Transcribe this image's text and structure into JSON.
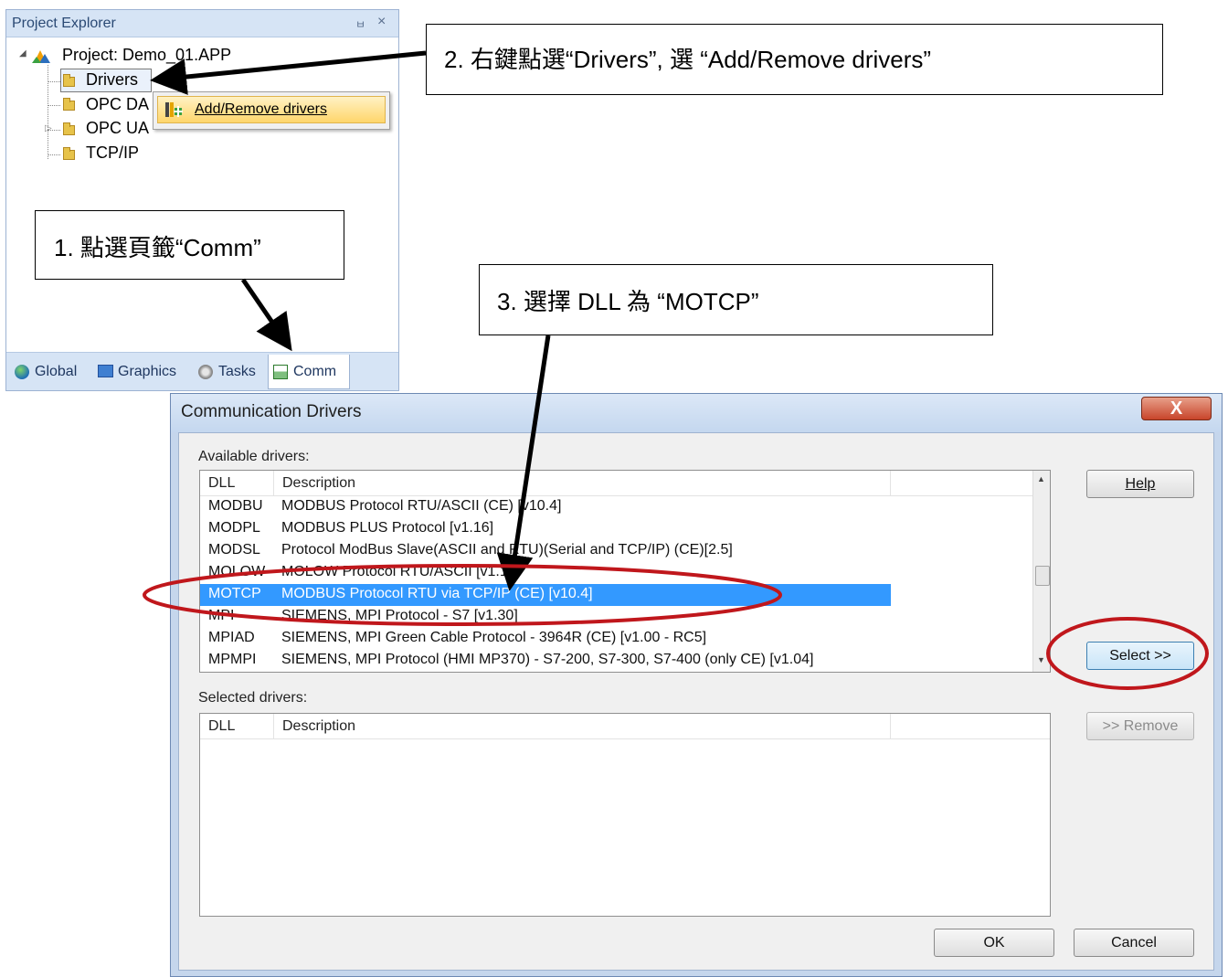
{
  "project_explorer": {
    "title": "Project Explorer",
    "pin_glyph": "ㅂ",
    "close_glyph": "×",
    "project_label": "Project: Demo_01.APP",
    "tree": [
      "Drivers",
      "OPC DA",
      "OPC UA",
      "TCP/IP"
    ],
    "context_menu_item": "Add/Remove drivers",
    "tabs": [
      "Global",
      "Graphics",
      "Tasks",
      "Comm"
    ]
  },
  "callouts": {
    "step1": "1.  點選頁籤“Comm”",
    "step2": "2. 右鍵點選“Drivers”, 選 “Add/Remove drivers”",
    "step3": "3. 選擇 DLL 為 “MOTCP”"
  },
  "dialog": {
    "title": "Communication Drivers",
    "close_glyph": "X",
    "available_label": "Available drivers:",
    "selected_label": "Selected drivers:",
    "columns": {
      "dll": "DLL",
      "description": "Description"
    },
    "available_rows": [
      {
        "dll": "MODBU",
        "description": "MODBUS Protocol RTU/ASCII (CE) [v10.4]"
      },
      {
        "dll": "MODPL",
        "description": "MODBUS PLUS Protocol  [v1.16]"
      },
      {
        "dll": "MODSL",
        "description": "Protocol ModBus Slave(ASCII and RTU)(Serial and TCP/IP) (CE)[2.5]"
      },
      {
        "dll": "MOLOW",
        "description": "MOLOW Protocol RTU/ASCII [v1.1]"
      },
      {
        "dll": "MOTCP",
        "description": "MODBUS Protocol RTU via TCP/IP (CE) [v10.4]"
      },
      {
        "dll": "MPI",
        "description": "SIEMENS, MPI Protocol - S7 [v1.30]"
      },
      {
        "dll": "MPIAD",
        "description": "SIEMENS, MPI Green Cable Protocol - 3964R (CE) [v1.00 - RC5]"
      },
      {
        "dll": "MPMPI",
        "description": "SIEMENS, MPI Protocol (HMI MP370) - S7-200, S7-300, S7-400 (only CE) [v1.04]"
      }
    ],
    "selected_row_index": 4,
    "buttons": {
      "help": "Help",
      "select": "Select >>",
      "remove": ">> Remove",
      "ok": "OK",
      "cancel": "Cancel"
    }
  },
  "colors": {
    "selection": "#3399ff",
    "annotation_red": "#c0171c",
    "arrow": "#000000"
  }
}
